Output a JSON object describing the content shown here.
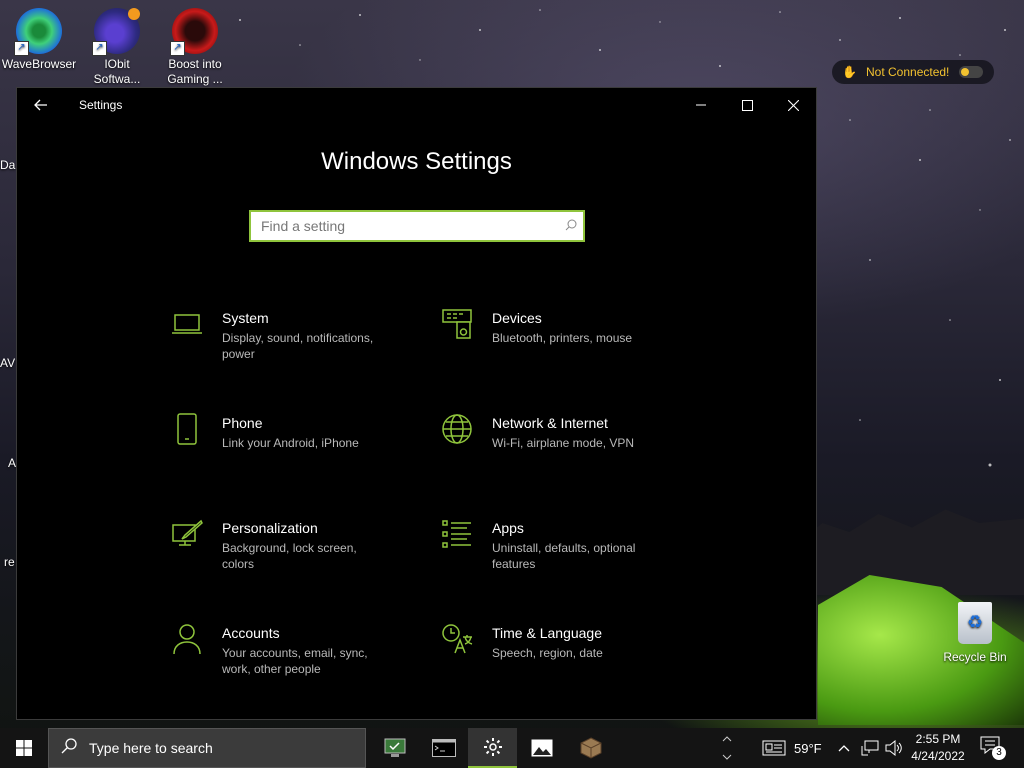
{
  "desktop": {
    "icons": [
      {
        "label_line1": "WaveBrowser",
        "label_line2": ""
      },
      {
        "label_line1": "IObit",
        "label_line2": "Softwa..."
      },
      {
        "label_line1": "Boost into",
        "label_line2": "Gaming ..."
      }
    ],
    "edge_fragments": [
      "Da",
      "AV",
      "A",
      "re"
    ],
    "vpn_widget": {
      "label": "Not Connected!"
    },
    "recycle_bin": {
      "label": "Recycle Bin"
    }
  },
  "window": {
    "title": "Settings",
    "heading": "Windows Settings",
    "search": {
      "placeholder": "Find a setting"
    },
    "categories": [
      {
        "name": "System",
        "desc": "Display, sound, notifications, power",
        "icon": "laptop-icon"
      },
      {
        "name": "Devices",
        "desc": "Bluetooth, printers, mouse",
        "icon": "devices-icon"
      },
      {
        "name": "Phone",
        "desc": "Link your Android, iPhone",
        "icon": "phone-icon"
      },
      {
        "name": "Network & Internet",
        "desc": "Wi-Fi, airplane mode, VPN",
        "icon": "globe-icon"
      },
      {
        "name": "Personalization",
        "desc": "Background, lock screen, colors",
        "icon": "paintbrush-icon"
      },
      {
        "name": "Apps",
        "desc": "Uninstall, defaults, optional features",
        "icon": "apps-list-icon"
      },
      {
        "name": "Accounts",
        "desc": "Your accounts, email, sync, work, other people",
        "icon": "person-icon"
      },
      {
        "name": "Time & Language",
        "desc": "Speech, region, date",
        "icon": "time-language-icon"
      }
    ]
  },
  "taskbar": {
    "search_placeholder": "Type here to search",
    "weather": "59°F",
    "time": "2:55 PM",
    "date": "4/24/2022",
    "notification_count": "3"
  },
  "colors": {
    "accent": "#8fc43c",
    "vpn": "#f2c230",
    "window_bg": "#000000",
    "taskbar_bg": "#141414"
  }
}
